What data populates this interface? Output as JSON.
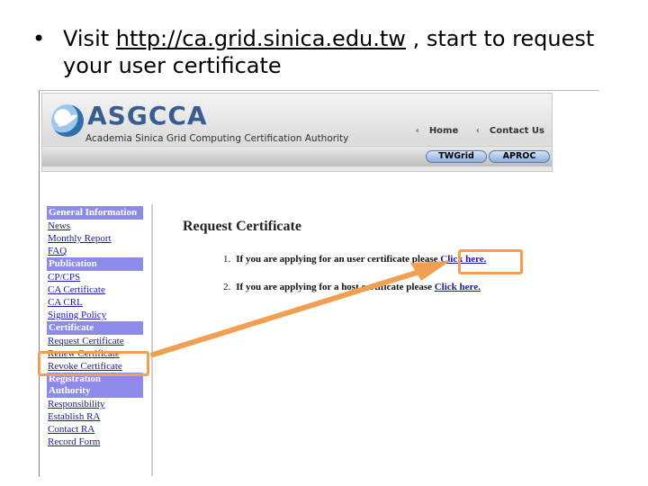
{
  "caption": {
    "bullet": "•",
    "prefix": "Visit ",
    "url": "http://ca.grid.sinica.edu.tw",
    "suffix": " , start to request your user certificate"
  },
  "site": {
    "logo_text": "ASGCCA",
    "logo_subtitle": "Academia Sinica Grid Computing Certification Authority",
    "top_links": [
      "Home",
      "Contact Us"
    ],
    "partner_buttons": [
      "TWGrid",
      "APROC"
    ]
  },
  "nav": {
    "sections": [
      {
        "header": "General Information",
        "links": [
          "News",
          "Monthly Report",
          "FAQ"
        ]
      },
      {
        "header": "Publication",
        "links": [
          "CP/CPS",
          "CA Certificate",
          "CA CRL",
          "Signing Policy"
        ]
      },
      {
        "header": "Certificate",
        "links": [
          "Request Certificate",
          "Renew Certificate",
          "Revoke Certificate"
        ]
      },
      {
        "header": "Registration Authority",
        "links": [
          "Responsibility",
          "Establish RA",
          "Contact RA",
          "Record Form"
        ]
      }
    ]
  },
  "main": {
    "title": "Request Certificate",
    "items": [
      {
        "number": "1.",
        "text": "If you are applying for an user certificate please ",
        "link": "Click here."
      },
      {
        "number": "2.",
        "text": "If you are applying for a host certificate please ",
        "link": "Click here."
      }
    ]
  },
  "colors": {
    "highlight": "#f0a050",
    "nav_header": "#8c8ce8",
    "link": "#1a1aa8"
  }
}
